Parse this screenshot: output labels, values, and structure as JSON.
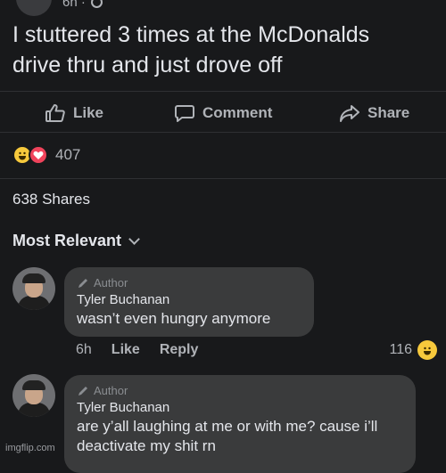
{
  "post": {
    "time": "6h ·",
    "text": "I stuttered 3 times at the McDonalds\ndrive thru and just drove off"
  },
  "actions": {
    "like": "Like",
    "comment": "Comment",
    "share": "Share"
  },
  "reactions": {
    "count": "407",
    "icons": [
      "haha-emoji-icon",
      "love-emoji-icon"
    ]
  },
  "shares": "638 Shares",
  "sort": {
    "label": "Most Relevant"
  },
  "comments": [
    {
      "badge": "Author",
      "name": "Tyler Buchanan",
      "text": "wasn’t even hungry anymore",
      "time": "6h",
      "like": "Like",
      "reply": "Reply",
      "reaction_count": "116"
    },
    {
      "badge": "Author",
      "name": "Tyler Buchanan",
      "text": "are y’all laughing at me or with me? cause i’ll deactivate my shit rn"
    }
  ],
  "watermark": "imgflip.com",
  "colors": {
    "background": "#18191b",
    "bubble": "#3a3b3c",
    "haha": "#f7c93c",
    "love": "#f0435b"
  }
}
